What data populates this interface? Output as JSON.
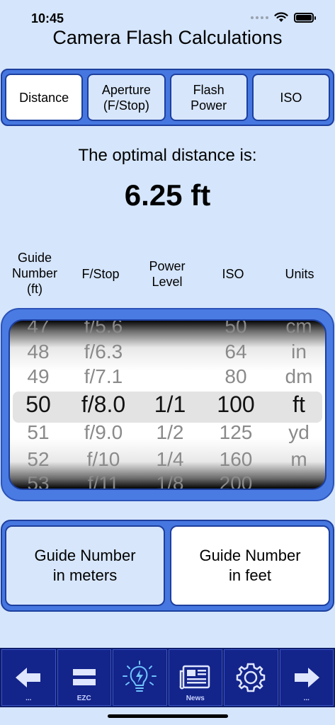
{
  "status_bar": {
    "time": "10:45"
  },
  "app": {
    "title": "Camera Flash Calculations"
  },
  "tabs": [
    {
      "label": "Distance",
      "active": true
    },
    {
      "label": "Aperture\n(F/Stop)",
      "active": false
    },
    {
      "label": "Flash\nPower",
      "active": false
    },
    {
      "label": "ISO",
      "active": false
    }
  ],
  "result": {
    "label": "The optimal distance is:",
    "value": "6.25 ft"
  },
  "columns": [
    {
      "label": "Guide\nNumber\n(ft)"
    },
    {
      "label": "F/Stop"
    },
    {
      "label": "Power\nLevel"
    },
    {
      "label": "ISO"
    },
    {
      "label": "Units"
    }
  ],
  "picker": {
    "columns": [
      {
        "items": [
          "47",
          "48",
          "49",
          "50",
          "51",
          "52",
          "53"
        ],
        "selected_index": 3
      },
      {
        "items": [
          "f/5.6",
          "f/6.3",
          "f/7.1",
          "f/8.0",
          "f/9.0",
          "f/10",
          "f/11"
        ],
        "selected_index": 3
      },
      {
        "items": [
          "",
          "",
          "",
          "1/1",
          "1/2",
          "1/4",
          "1/8"
        ],
        "selected_index": 3
      },
      {
        "items": [
          "50",
          "64",
          "80",
          "100",
          "125",
          "160",
          "200"
        ],
        "selected_index": 3
      },
      {
        "items": [
          "cm",
          "in",
          "dm",
          "ft",
          "yd",
          "m",
          ""
        ],
        "selected_index": 3
      }
    ]
  },
  "guide_number_units": [
    {
      "label": "Guide Number\nin meters",
      "active": false
    },
    {
      "label": "Guide Number\nin feet",
      "active": true
    }
  ],
  "toolbar": [
    {
      "icon": "arrow-left-icon",
      "sub": "..."
    },
    {
      "icon": "equals-icon",
      "sub": "EZC"
    },
    {
      "icon": "lightbulb-icon",
      "sub": ""
    },
    {
      "icon": "newspaper-icon",
      "sub": "News"
    },
    {
      "icon": "gear-icon",
      "sub": ""
    },
    {
      "icon": "arrow-right-icon",
      "sub": "..."
    }
  ],
  "colors": {
    "background": "#d5e5fb",
    "accent": "#4677e0",
    "toolbar": "#13248a"
  }
}
